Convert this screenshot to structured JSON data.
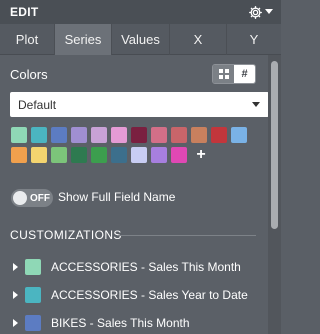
{
  "header": {
    "title": "EDIT",
    "gear_icon": "gear-icon",
    "menu_icon": "caret-down-icon"
  },
  "tabs": [
    {
      "label": "Plot",
      "active": false
    },
    {
      "label": "Series",
      "active": true
    },
    {
      "label": "Values",
      "active": false
    },
    {
      "label": "X",
      "active": false
    },
    {
      "label": "Y",
      "active": false
    }
  ],
  "colors": {
    "label": "Colors",
    "view_toggle": {
      "grid_icon": "grid-icon",
      "hash_label": "#"
    },
    "palette_select": {
      "value": "Default"
    },
    "swatches": [
      "#8fd8b6",
      "#4bb5c1",
      "#5c7cc2",
      "#a08fd1",
      "#c8a2d6",
      "#e59bd5",
      "#7a2040",
      "#d36f88",
      "#c8656a",
      "#c8805e",
      "#c2363c",
      "#7ab2e6",
      "#f0a04d",
      "#f3d46f",
      "#7cc47a",
      "#2e7a50",
      "#3c9e4e",
      "#3c6f8c",
      "#c8cdf3",
      "#a77fdf",
      "#e048b4"
    ],
    "add_label": "+"
  },
  "full_field_name": {
    "toggle_text": "OFF",
    "label": "Show Full Field Name"
  },
  "customizations": {
    "title": "CUSTOMIZATIONS",
    "series": [
      {
        "label": "ACCESSORIES - Sales This Month",
        "color": "#8fd8b6"
      },
      {
        "label": "ACCESSORIES - Sales Year to Date",
        "color": "#4bb5c1"
      },
      {
        "label": "BIKES - Sales This Month",
        "color": "#5c7cc2"
      }
    ]
  }
}
